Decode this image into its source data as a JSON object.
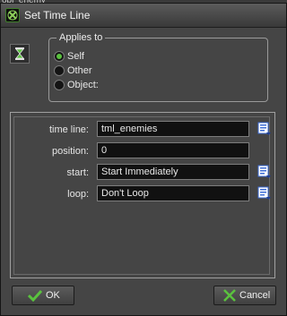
{
  "background_window": {
    "title": "obj_enemy"
  },
  "window": {
    "title": "Set Time Line",
    "icon": "app-icon"
  },
  "action_icon": "timeline-hourglass-icon",
  "applies_to": {
    "legend": "Applies to",
    "options": [
      {
        "label": "Self",
        "selected": true
      },
      {
        "label": "Other",
        "selected": false
      },
      {
        "label": "Object:",
        "selected": false
      }
    ]
  },
  "fields": [
    {
      "label": "time line:",
      "value": "tml_enemies",
      "has_picker": true
    },
    {
      "label": "position:",
      "value": "0",
      "has_picker": false
    },
    {
      "label": "start:",
      "value": "Start Immediately",
      "has_picker": true
    },
    {
      "label": "loop:",
      "value": "Don't Loop",
      "has_picker": true
    }
  ],
  "buttons": {
    "ok": "OK",
    "cancel": "Cancel"
  },
  "colors": {
    "accent_green": "#5ac23e",
    "picker_blue": "#3c6cd6"
  }
}
